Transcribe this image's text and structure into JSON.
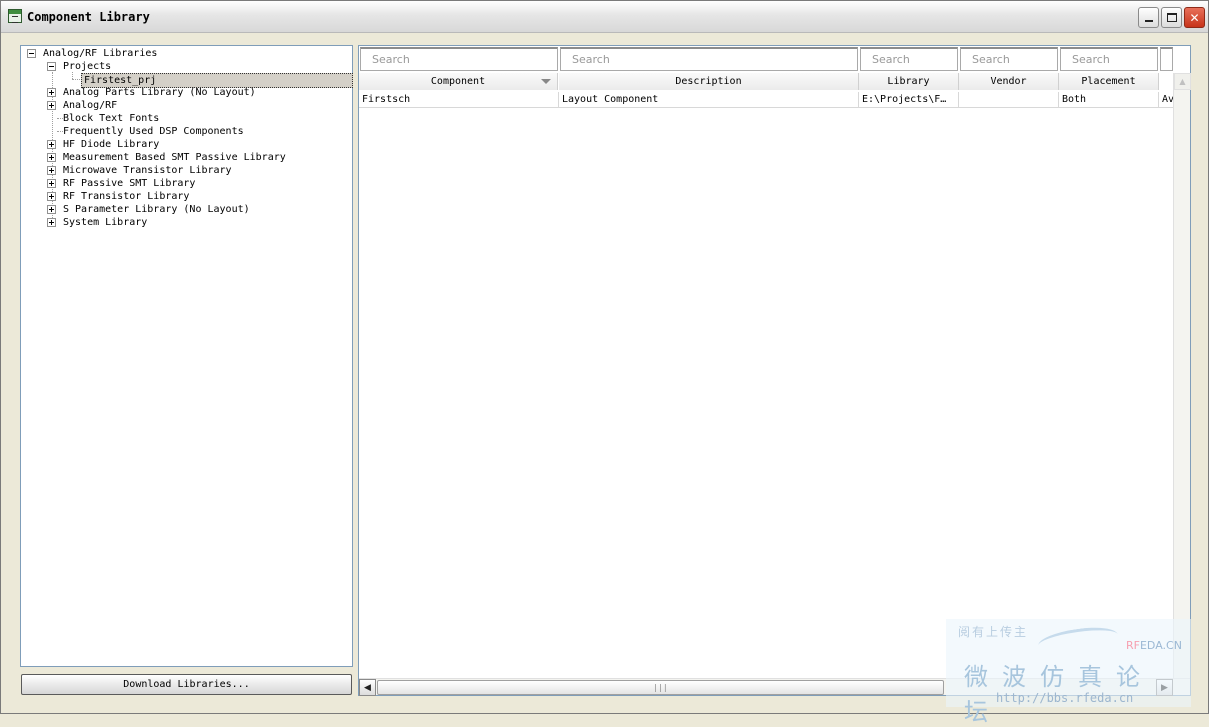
{
  "window": {
    "title": "Component Library",
    "controls": {
      "minimize": "minimize",
      "maximize": "maximize",
      "close": "✕"
    }
  },
  "tree": {
    "root": "Analog/RF Libraries",
    "projects": "Projects",
    "selected": "Firstest_prj",
    "items": [
      {
        "label": "Analog Parts Library (No Layout)",
        "expandable": true
      },
      {
        "label": "Analog/RF",
        "expandable": true
      },
      {
        "label": "Block Text Fonts",
        "expandable": false
      },
      {
        "label": "Frequently Used DSP Components",
        "expandable": false
      },
      {
        "label": "HF Diode Library",
        "expandable": true
      },
      {
        "label": "Measurement Based SMT Passive Library",
        "expandable": true
      },
      {
        "label": "Microwave Transistor Library",
        "expandable": true
      },
      {
        "label": "RF Passive SMT Library",
        "expandable": true
      },
      {
        "label": "RF Transistor Library",
        "expandable": true
      },
      {
        "label": "S Parameter Library (No Layout)",
        "expandable": true
      },
      {
        "label": "System Library",
        "expandable": true
      }
    ]
  },
  "download_button": "Download Libraries...",
  "table": {
    "search_placeholders": [
      "Search",
      "Search",
      "Search",
      "Search",
      "Search",
      "Search"
    ],
    "columns": [
      "Component",
      "Description",
      "Library",
      "Vendor",
      "Placement",
      "Av"
    ],
    "rows": [
      [
        "Firstsch",
        "Layout Component",
        "E:\\Projects\\F…",
        "",
        "Both",
        "Av"
      ]
    ]
  },
  "watermark": {
    "tagline": "阅有上传主",
    "logo_a": "RF",
    "logo_b": "EDA.CN",
    "title": "微波仿真论坛",
    "url": "http://bbs.rfeda.cn"
  }
}
